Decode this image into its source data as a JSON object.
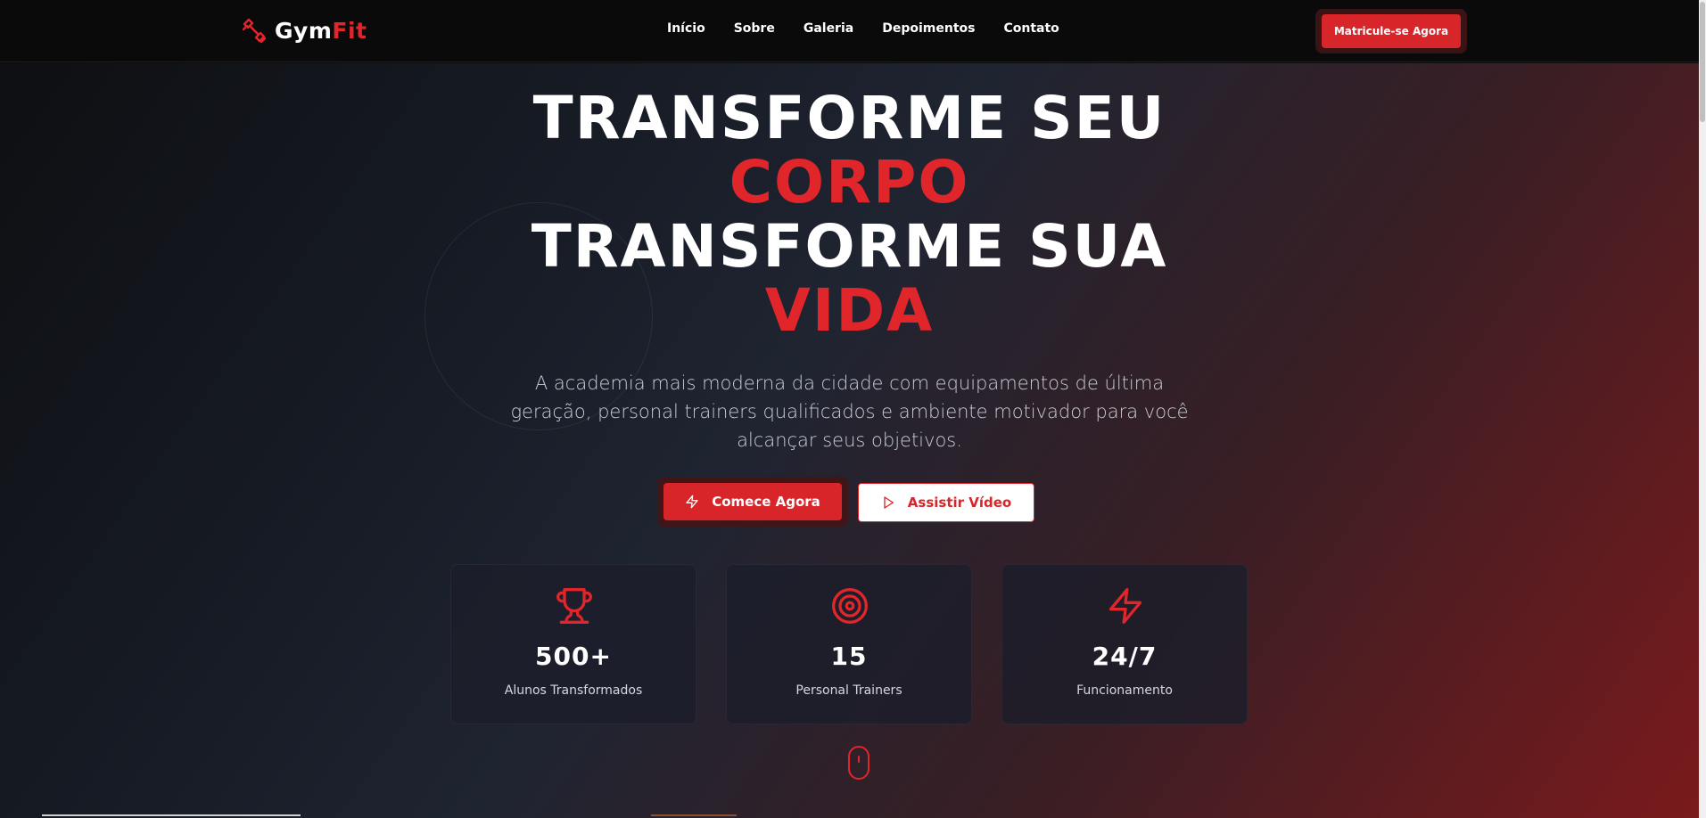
{
  "brand": {
    "name_part1": "Gym",
    "name_part2": "Fit",
    "accent": "#e0262b",
    "icon": "dumbbell-icon"
  },
  "nav": {
    "links": [
      "Início",
      "Sobre",
      "Galeria",
      "Depoimentos",
      "Contato"
    ],
    "cta": "Matricule-se Agora"
  },
  "hero": {
    "line1": "TRANSFORME SEU",
    "line2": "CORPO",
    "line3": "TRANSFORME SUA",
    "line4": "VIDA",
    "subtitle": "A academia mais moderna da cidade com equipamentos de última geração, personal trainers qualificados e ambiente motivador para você alcançar seus objetivos.",
    "primary_cta": "Comece Agora",
    "primary_icon": "lightning-icon",
    "secondary_cta": "Assistir Vídeo",
    "secondary_icon": "play-icon"
  },
  "stats": [
    {
      "icon": "trophy-icon",
      "value": "500+",
      "label": "Alunos Transformados"
    },
    {
      "icon": "target-icon",
      "value": "15",
      "label": "Personal Trainers"
    },
    {
      "icon": "lightning-icon",
      "value": "24/7",
      "label": "Funcionamento"
    }
  ]
}
